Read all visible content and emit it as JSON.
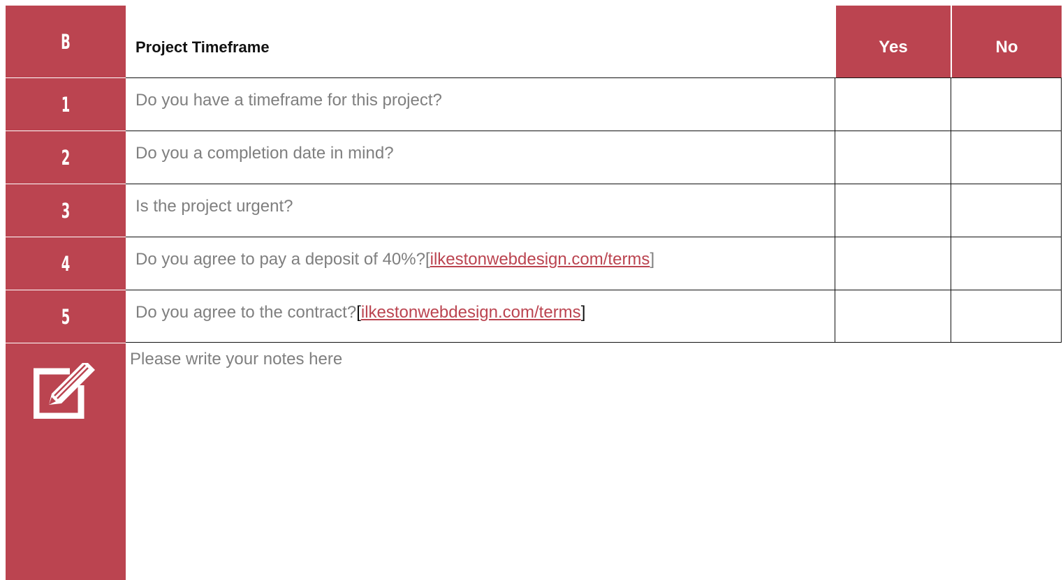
{
  "section": {
    "letter": "B",
    "title": "Project Timeframe",
    "col_yes": "Yes",
    "col_no": "No"
  },
  "questions": [
    {
      "num": "1",
      "text": "Do you have a timeframe for this project?",
      "link": ""
    },
    {
      "num": "2",
      "text": "Do you a completion date in mind?",
      "link": ""
    },
    {
      "num": "3",
      "text": "Is the project urgent?",
      "link": ""
    },
    {
      "num": "4",
      "text": "Do you agree to pay a deposit of 40%? ",
      "link": "ilkestonwebdesign.com/terms"
    },
    {
      "num": "5",
      "text": "Do you agree to the contract? ",
      "link": "ilkestonwebdesign.com/terms"
    }
  ],
  "notes": {
    "placeholder": "Please write your notes here",
    "icon": "edit-note-icon"
  },
  "colors": {
    "accent": "#bb4450",
    "body_text": "#7f7f7f",
    "grid": "#111111"
  }
}
